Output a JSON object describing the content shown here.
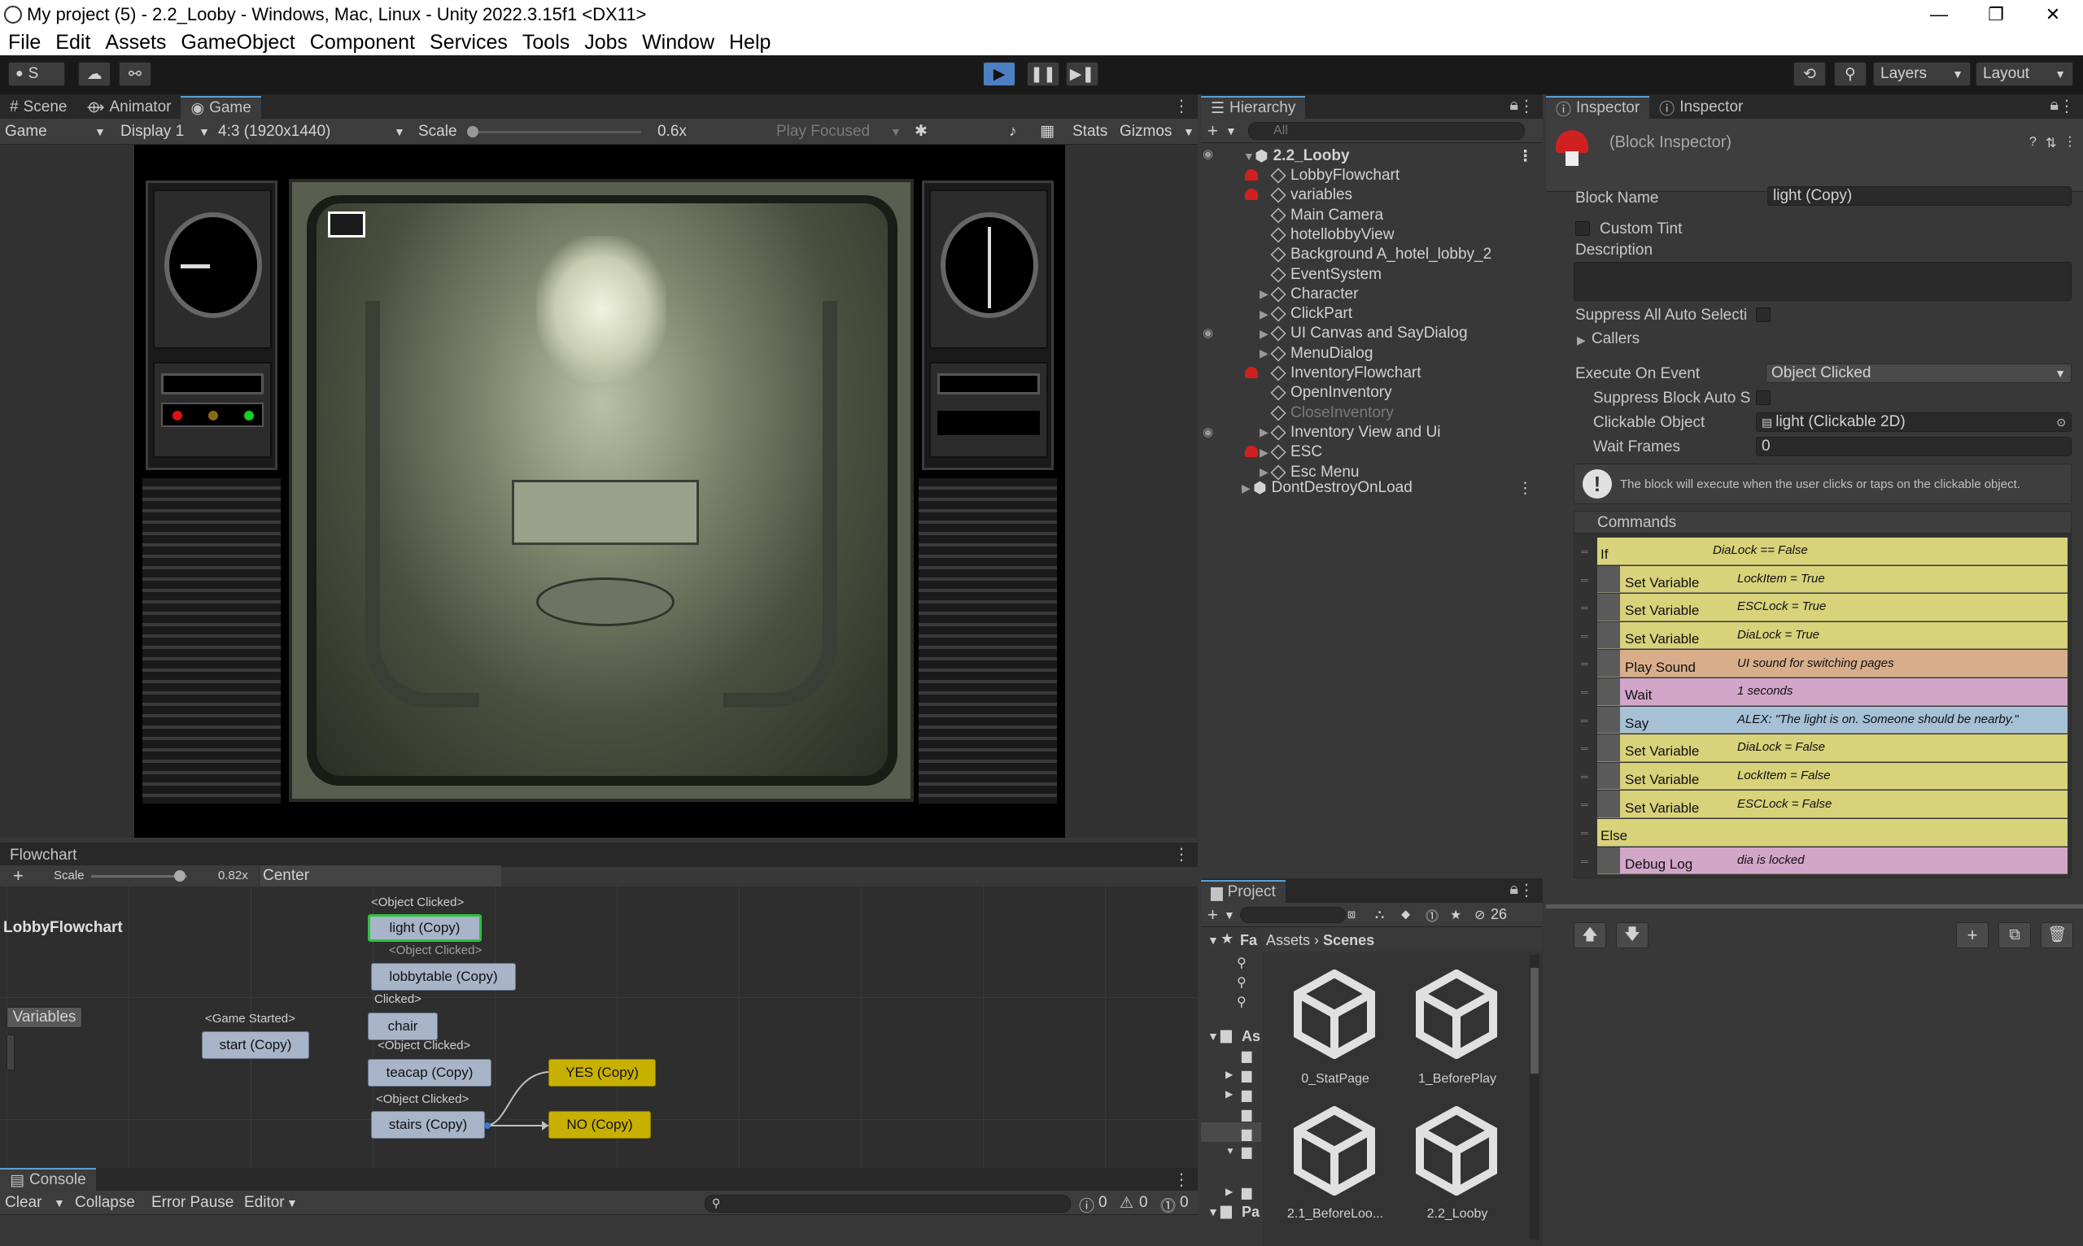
{
  "window": {
    "title": "My project (5) - 2.2_Looby - Windows, Mac, Linux - Unity 2022.3.15f1 <DX11>",
    "minimize": "—",
    "maximize": "❐",
    "close": "✕"
  },
  "menu": [
    "File",
    "Edit",
    "Assets",
    "GameObject",
    "Component",
    "Services",
    "Tools",
    "Jobs",
    "Window",
    "Help"
  ],
  "toolbar": {
    "account": "S",
    "layers": "Layers",
    "layout": "Layout"
  },
  "scene_tabs": [
    "Scene",
    "Animator",
    "Game"
  ],
  "game_bar": {
    "mode": "Game",
    "display": "Display 1",
    "aspect": "4:3 (1920x1440)",
    "scale_label": "Scale",
    "scale_value": "0.6x",
    "play_focused": "Play Focused",
    "stats": "Stats",
    "gizmos": "Gizmos"
  },
  "hierarchy": {
    "tab": "Hierarchy",
    "search_placeholder": "All",
    "scene": "2.2_Looby",
    "items": [
      {
        "name": "LobbyFlowchart",
        "mush": true,
        "expand": false
      },
      {
        "name": "variables",
        "mush": true,
        "expand": false
      },
      {
        "name": "Main Camera",
        "mush": false,
        "expand": false
      },
      {
        "name": "hotellobbyView",
        "mush": false,
        "expand": false
      },
      {
        "name": "Background A_hotel_lobby_2",
        "mush": false,
        "expand": false
      },
      {
        "name": "EventSystem",
        "mush": false,
        "expand": false
      },
      {
        "name": "Character",
        "mush": false,
        "expand": true
      },
      {
        "name": "ClickPart",
        "mush": false,
        "expand": true
      },
      {
        "name": "UI Canvas and SayDialog",
        "mush": false,
        "expand": true
      },
      {
        "name": "MenuDialog",
        "mush": false,
        "expand": true
      },
      {
        "name": "InventoryFlowchart",
        "mush": true,
        "expand": false
      },
      {
        "name": "OpenInventory",
        "mush": false,
        "expand": false
      },
      {
        "name": "CloseInventory",
        "mush": false,
        "expand": false,
        "dim": true
      },
      {
        "name": "Inventory View and Ui",
        "mush": false,
        "expand": true
      },
      {
        "name": "ESC",
        "mush": true,
        "expand": true
      },
      {
        "name": "Esc Menu",
        "mush": false,
        "expand": true
      }
    ],
    "dontdestroy": "DontDestroyOnLoad"
  },
  "inspector": {
    "tabs": [
      "Inspector",
      "Inspector"
    ],
    "header": "(Block Inspector)",
    "block_name_label": "Block Name",
    "block_name": "light (Copy)",
    "custom_tint": "Custom Tint",
    "description": "Description",
    "suppress_all": "Suppress All Auto Selecti",
    "callers": "Callers",
    "execute_label": "Execute On Event",
    "execute_value": "Object Clicked",
    "suppress_block": "Suppress Block Auto S",
    "clickable_label": "Clickable Object",
    "clickable_value": "light (Clickable 2D)",
    "wait_label": "Wait Frames",
    "wait_value": "0",
    "info": "The block will execute when the user clicks or taps on the clickable object.",
    "commands_label": "Commands",
    "commands": [
      {
        "name": "If",
        "summary": "DiaLock == False",
        "color": "#d8d27a",
        "indent": 0
      },
      {
        "name": "Set Variable",
        "summary": "LockItem = True",
        "color": "#d8d27a",
        "indent": 1
      },
      {
        "name": "Set Variable",
        "summary": "ESCLock = True",
        "color": "#d8d27a",
        "indent": 1
      },
      {
        "name": "Set Variable",
        "summary": "DiaLock = True",
        "color": "#d8d27a",
        "indent": 1
      },
      {
        "name": "Play Sound",
        "summary": "UI sound for switching pages",
        "color": "#d8ae8a",
        "indent": 1
      },
      {
        "name": "Wait",
        "summary": "1 seconds",
        "color": "#d2a6c8",
        "indent": 1
      },
      {
        "name": "Say",
        "summary": "ALEX: \"The light is on. Someone should be nearby.\"",
        "color": "#a6c0d6",
        "indent": 1
      },
      {
        "name": "Set Variable",
        "summary": "DiaLock = False",
        "color": "#d8d27a",
        "indent": 1
      },
      {
        "name": "Set Variable",
        "summary": "LockItem = False",
        "color": "#d8d27a",
        "indent": 1
      },
      {
        "name": "Set Variable",
        "summary": "ESCLock = False",
        "color": "#d8d27a",
        "indent": 1
      },
      {
        "name": "Else",
        "summary": "",
        "color": "#d8d27a",
        "indent": 0
      },
      {
        "name": "Debug Log",
        "summary": "dia is locked",
        "color": "#d2a6c8",
        "indent": 1
      }
    ]
  },
  "flowchart": {
    "tab": "Flowchart",
    "scale_label": "Scale",
    "scale_value": "0.82x",
    "center": "Center",
    "name": "LobbyFlowchart",
    "variables": "Variables",
    "labels": {
      "obj1": "<Object Clicked>",
      "obj2": "<Object Clicked>",
      "obj3": "Clicked>",
      "game": "<Game Started>",
      "obj4": "<Object Clicked>",
      "obj5": "<Object Clicked>"
    },
    "nodes": {
      "light": "light (Copy)",
      "lobbytable": "lobbytable (Copy)",
      "chair": "chair",
      "start": "start (Copy)",
      "teacap": "teacap (Copy)",
      "stairs": "stairs (Copy)",
      "yes": "YES (Copy)",
      "no": "NO (Copy)"
    }
  },
  "project": {
    "tab": "Project",
    "count": "26",
    "breadcrumb_root": "Assets",
    "breadcrumb_leaf": "Scenes",
    "fav": "Fa",
    "as": "As",
    "pa": "Pa",
    "assets": [
      "0_StatPage",
      "1_BeforePlay",
      "2.1_BeforeLoo...",
      "2.2_Looby"
    ]
  },
  "console": {
    "tab": "Console",
    "clear": "Clear",
    "collapse": "Collapse",
    "error_pause": "Error Pause",
    "editor": "Editor",
    "count_log": "0",
    "count_warn": "0",
    "count_err": "0"
  }
}
